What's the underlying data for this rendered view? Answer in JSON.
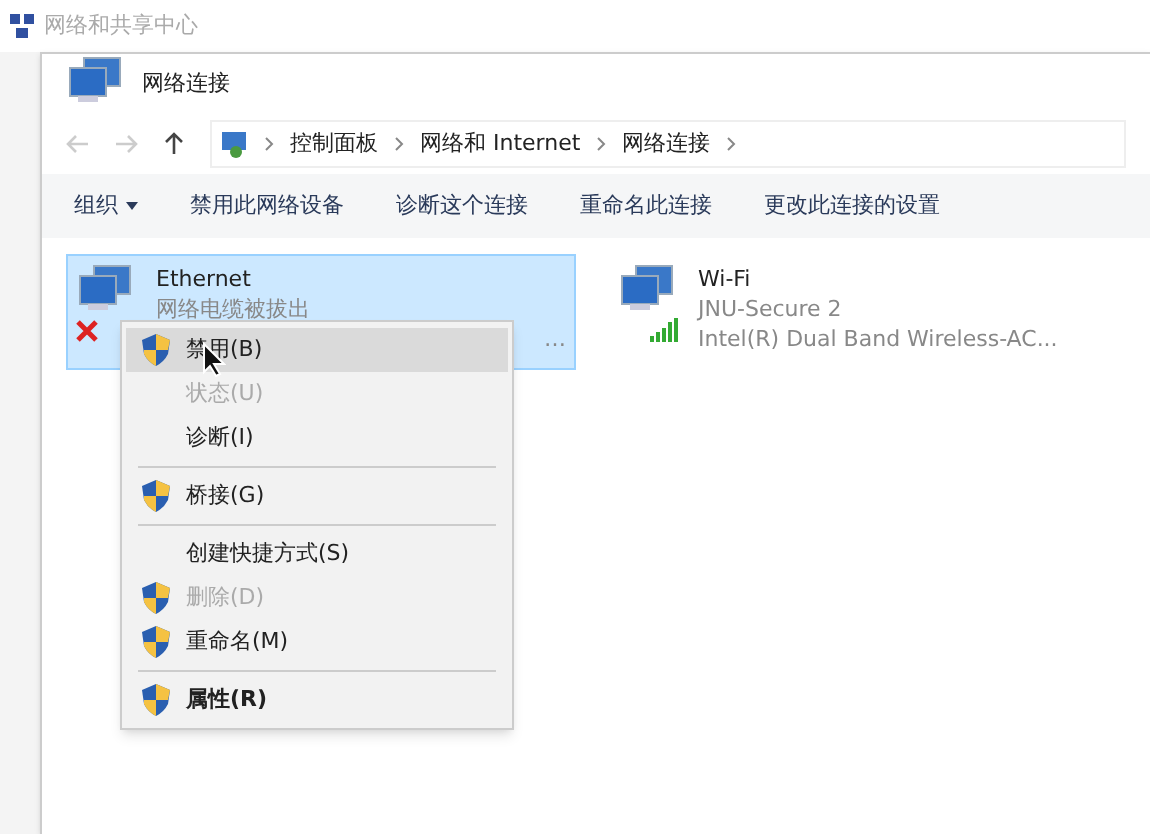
{
  "back_window": {
    "title": "网络和共享中心"
  },
  "window": {
    "title": "网络连接"
  },
  "breadcrumb": [
    "控制面板",
    "网络和 Internet",
    "网络连接"
  ],
  "toolbar": [
    {
      "label": "组织",
      "kind": "dropdown"
    },
    {
      "label": "禁用此网络设备",
      "kind": "button"
    },
    {
      "label": "诊断这个连接",
      "kind": "button"
    },
    {
      "label": "重命名此连接",
      "kind": "button"
    },
    {
      "label": "更改此连接的设置",
      "kind": "button"
    }
  ],
  "connections": [
    {
      "name": "Ethernet",
      "status": "网络电缆被拔出",
      "adapter": "…",
      "kind": "wired",
      "selected": true,
      "disconnected": true
    },
    {
      "name": "Wi-Fi",
      "status": "JNU-Secure  2",
      "adapter": "Intel(R) Dual Band Wireless-AC...",
      "kind": "wireless",
      "selected": false,
      "disconnected": false
    }
  ],
  "context_menu": [
    {
      "kind": "item",
      "label": "禁用(B)",
      "shield": true,
      "disabled": false,
      "selected": true,
      "bold": false
    },
    {
      "kind": "item",
      "label": "状态(U)",
      "shield": false,
      "disabled": true,
      "selected": false,
      "bold": false
    },
    {
      "kind": "item",
      "label": "诊断(I)",
      "shield": false,
      "disabled": false,
      "selected": false,
      "bold": false
    },
    {
      "kind": "separator"
    },
    {
      "kind": "item",
      "label": "桥接(G)",
      "shield": true,
      "disabled": false,
      "selected": false,
      "bold": false
    },
    {
      "kind": "separator"
    },
    {
      "kind": "item",
      "label": "创建快捷方式(S)",
      "shield": false,
      "disabled": false,
      "selected": false,
      "bold": false
    },
    {
      "kind": "item",
      "label": "删除(D)",
      "shield": true,
      "disabled": true,
      "selected": false,
      "bold": false
    },
    {
      "kind": "item",
      "label": "重命名(M)",
      "shield": true,
      "disabled": false,
      "selected": false,
      "bold": false
    },
    {
      "kind": "separator"
    },
    {
      "kind": "item",
      "label": "属性(R)",
      "shield": true,
      "disabled": false,
      "selected": false,
      "bold": true
    }
  ]
}
